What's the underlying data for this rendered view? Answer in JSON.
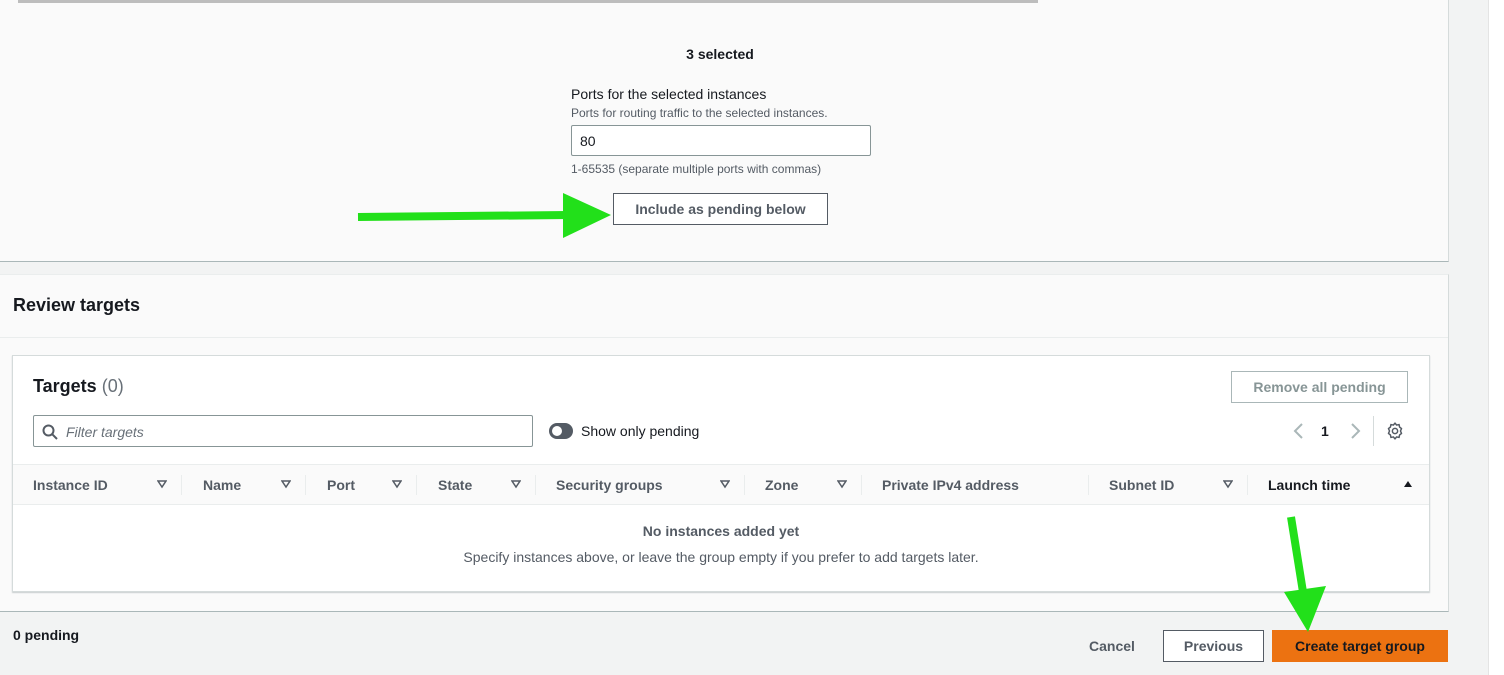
{
  "colors": {
    "accent_orange": "#ec7211",
    "annotation_arrow": "#22e01a",
    "text_primary": "#16191f",
    "text_secondary": "#545b64"
  },
  "register": {
    "selected_count": "3 selected",
    "ports_label": "Ports for the selected instances",
    "ports_description": "Ports for routing traffic to the selected instances.",
    "ports_value": "80",
    "ports_hint": "1-65535 (separate multiple ports with commas)",
    "include_button": "Include as pending below"
  },
  "review": {
    "title": "Review targets",
    "targets_title": "Targets",
    "targets_count": "(0)",
    "remove_all_button": "Remove all pending",
    "filter_placeholder": "Filter targets",
    "show_only_pending_label": "Show only pending",
    "show_only_pending_on": false,
    "current_page": "1",
    "columns": [
      {
        "label": "Instance ID",
        "icon": "sort-desc-icon"
      },
      {
        "label": "Name",
        "icon": "sort-desc-icon"
      },
      {
        "label": "Port",
        "icon": "sort-desc-icon"
      },
      {
        "label": "State",
        "icon": "sort-desc-icon"
      },
      {
        "label": "Security groups",
        "icon": "sort-desc-icon"
      },
      {
        "label": "Zone",
        "icon": "sort-desc-icon"
      },
      {
        "label": "Private IPv4 address",
        "icon": ""
      },
      {
        "label": "Subnet ID",
        "icon": "sort-desc-icon"
      },
      {
        "label": "Launch time",
        "icon": "sort-asc-active-icon"
      }
    ],
    "empty_title": "No instances added yet",
    "empty_description": "Specify instances above, or leave the group empty if you prefer to add targets later."
  },
  "footer": {
    "pending_text": "0 pending",
    "cancel_button": "Cancel",
    "previous_button": "Previous",
    "create_button": "Create target group"
  }
}
